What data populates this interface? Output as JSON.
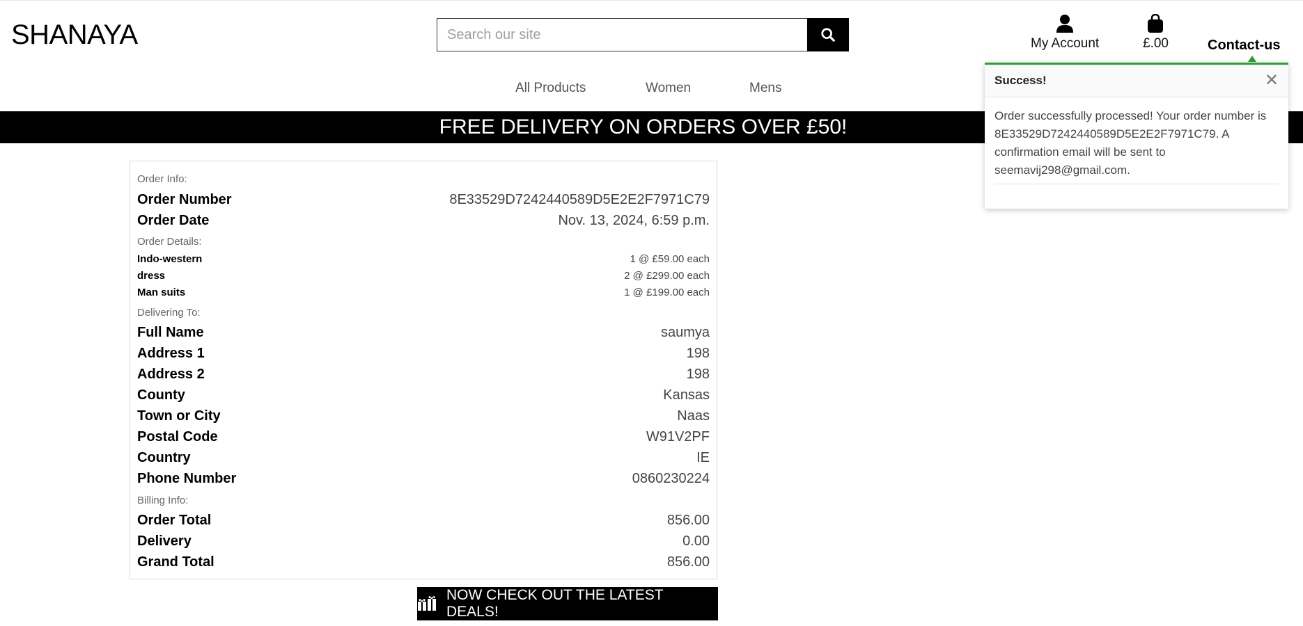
{
  "brand": {
    "logo_text": "SHANAYA"
  },
  "search": {
    "placeholder": "Search our site"
  },
  "header": {
    "account_label": "My Account",
    "bag_total": "£.00",
    "contact_label": "Contact-us"
  },
  "nav": {
    "items": [
      "All Products",
      "Women",
      "Mens"
    ]
  },
  "banner": {
    "text": "FREE DELIVERY ON ORDERS OVER £50!"
  },
  "order": {
    "order_info_label": "Order Info:",
    "order_number_label": "Order Number",
    "order_number": "8E33529D7242440589D5E2E2F7971C79",
    "order_date_label": "Order Date",
    "order_date": "Nov. 13, 2024, 6:59 p.m.",
    "order_details_label": "Order Details:",
    "line_items": [
      {
        "name": "Indo-western",
        "qty_price": "1 @ £59.00 each"
      },
      {
        "name": "dress",
        "qty_price": "2 @ £299.00 each"
      },
      {
        "name": "Man suits",
        "qty_price": "1 @ £199.00 each"
      }
    ],
    "delivering_to_label": "Delivering To:",
    "delivery": [
      {
        "label": "Full Name",
        "value": "saumya"
      },
      {
        "label": "Address 1",
        "value": "198"
      },
      {
        "label": "Address 2",
        "value": "198"
      },
      {
        "label": "County",
        "value": "Kansas"
      },
      {
        "label": "Town or City",
        "value": "Naas"
      },
      {
        "label": "Postal Code",
        "value": "W91V2PF"
      },
      {
        "label": "Country",
        "value": "IE"
      },
      {
        "label": "Phone Number",
        "value": "0860230224"
      }
    ],
    "billing_info_label": "Billing Info:",
    "billing": [
      {
        "label": "Order Total",
        "value": "856.00"
      },
      {
        "label": "Delivery",
        "value": "0.00"
      },
      {
        "label": "Grand Total",
        "value": "856.00"
      }
    ]
  },
  "cta": {
    "deals_label": "NOW CHECK OUT THE LATEST DEALS!"
  },
  "toast": {
    "title": "Success!",
    "close_glyph": "✕",
    "message": "Order successfully processed! Your order number is 8E33529D7242440589D5E2E2F7971C79. A confirmation email will be sent to seemavij298@gmail.com."
  },
  "colors": {
    "accent_success": "#2aa02f",
    "banner_bg": "#000000"
  }
}
